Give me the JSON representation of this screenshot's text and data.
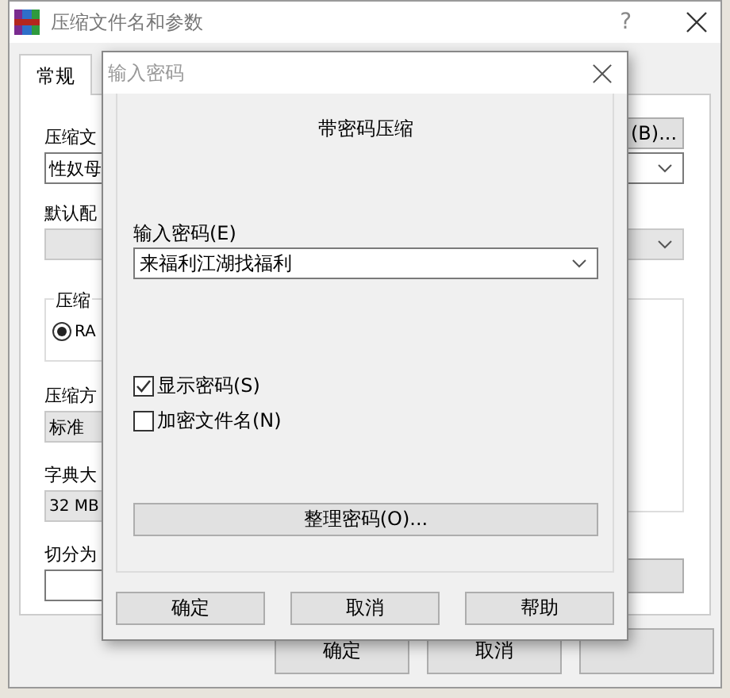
{
  "window": {
    "title": "压缩文件名和参数",
    "help": "?"
  },
  "tabs": [
    {
      "label": "常规",
      "selected": true
    }
  ],
  "panel": {
    "archive_label": "压缩文",
    "archive_name": "性奴母",
    "browse_button": "(B)...",
    "profile_label": "默认配",
    "format_group_label": "压缩",
    "format_radio": {
      "label": "RA",
      "selected": true
    },
    "method_label": "压缩方",
    "method_value": "标准",
    "dict_label": "字典大",
    "dict_value": "32 MB",
    "split_label": "切分为"
  },
  "buttons": [
    "确定",
    "取消"
  ],
  "dialog": {
    "title": "输入密码",
    "heading": "带密码压缩",
    "password_label": "输入密码(E)",
    "password_value": "来福利江湖找福利",
    "checkboxes": [
      {
        "label": "显示密码(S)",
        "checked": true
      },
      {
        "label": "加密文件名(N)",
        "checked": false
      }
    ],
    "organize_button": "整理密码(O)...",
    "buttons": [
      "确定",
      "取消",
      "帮助"
    ]
  }
}
